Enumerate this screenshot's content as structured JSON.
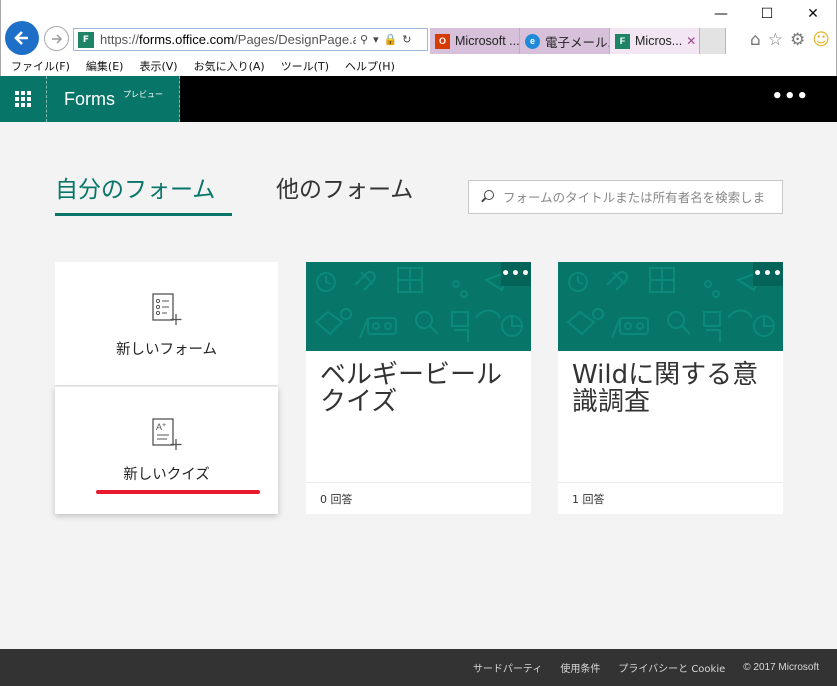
{
  "browser": {
    "url": "https://forms.office.com/Pages/DesignPage.aspx",
    "url_host": "forms.office.com",
    "url_prefix": "https://",
    "url_path": "/Pages/DesignPage.aspx",
    "tabs": [
      {
        "label": "Microsoft ...",
        "icon": "office-icon",
        "color": "#d83b01"
      },
      {
        "label": "電子メール...",
        "icon": "ie-icon",
        "color": "#1f8ad8"
      },
      {
        "label": "Micros...",
        "icon": "forms-icon",
        "color": "#1d8466",
        "active": true
      }
    ],
    "menu": [
      "ファイル(F)",
      "編集(E)",
      "表示(V)",
      "お気に入り(A)",
      "ツール(T)",
      "ヘルプ(H)"
    ]
  },
  "header": {
    "brand": "Forms",
    "tag": "プレビュー",
    "more": "•••",
    "accent": "#077568"
  },
  "main": {
    "tab_mine": "自分のフォーム",
    "tab_others": "他のフォーム",
    "search_placeholder": "フォームのタイトルまたは所有者名を検索しま"
  },
  "new_form": {
    "label": "新しいフォーム"
  },
  "new_quiz": {
    "label": "新しいクイズ"
  },
  "cards": [
    {
      "title": "ベルギービール クイズ",
      "responses": "0 回答",
      "more": "•••"
    },
    {
      "title": "Wildに関する意識調査",
      "responses": "1 回答",
      "more": "•••"
    }
  ],
  "footer": {
    "links": [
      "サードパーティ",
      "使用条件",
      "プライバシーと Cookie"
    ],
    "copyright": "© 2017 Microsoft"
  }
}
